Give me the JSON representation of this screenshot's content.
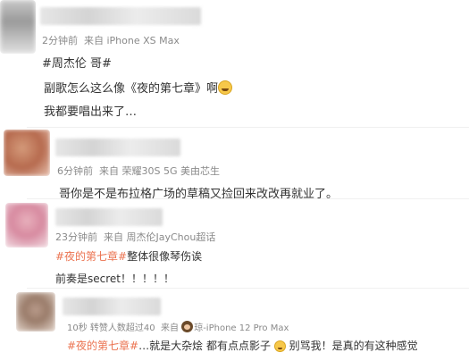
{
  "posts": [
    {
      "meta_time": "2分钟前",
      "meta_source": "来自 iPhone XS Max",
      "tag": "#周杰伦 哥#",
      "line1": "副歌怎么这么像《夜的第七章》啊",
      "line2": "我都要唱出来了…"
    },
    {
      "meta_time": "6分钟前",
      "meta_source": "来自 荣耀30S 5G 美由芯生",
      "line1": "哥你是不是布拉格广场的草稿又捡回来改改再就业了。"
    },
    {
      "meta_time": "23分钟前",
      "meta_source": "来自 周杰伦JayChou超话",
      "tag": "#夜的第七章#",
      "line1_rest": "整体很像琴伤诶",
      "line2": "前奏是secret！！！！！"
    },
    {
      "meta_time": "10秒",
      "meta_reposts": "转赞人数超过40",
      "meta_source_prefix": "来自",
      "meta_source": "琼-iPhone 12 Pro Max",
      "tag": "#夜的第七章#",
      "line1_mid": "…就是大杂烩 都有点点影子",
      "line1_mid2": "别骂我！是真的有这种感觉"
    }
  ],
  "colors": {
    "tag": "#eb7350",
    "meta": "#8a8a8a",
    "text": "#333333"
  },
  "icons": [
    "grin-emoji-icon",
    "user-avatar-badge-icon"
  ]
}
